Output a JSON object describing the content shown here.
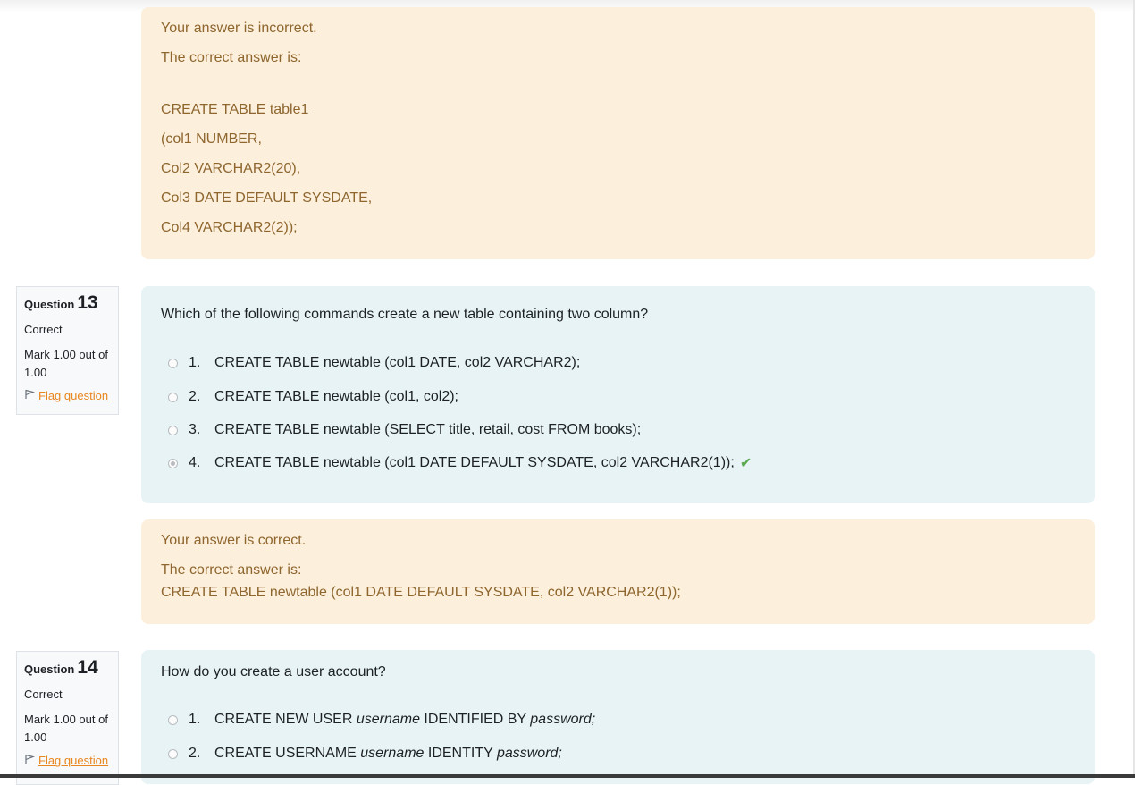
{
  "prev_feedback": {
    "lines": [
      "Your answer is incorrect.",
      "The correct answer is:",
      "CREATE TABLE table1",
      "(col1 NUMBER,",
      "Col2 VARCHAR2(20),",
      "Col3 DATE DEFAULT SYSDATE,",
      "Col4 VARCHAR2(2));"
    ]
  },
  "questions": [
    {
      "label": "Question",
      "number": "13",
      "state": "Correct",
      "grade": "Mark 1.00 out of 1.00",
      "flag": "Flag question",
      "text": "Which of the following commands create a new table containing two column?",
      "options": [
        {
          "num": "1.",
          "text": "CREATE TABLE newtable (col1 DATE, col2 VARCHAR2);"
        },
        {
          "num": "2.",
          "text": "CREATE TABLE newtable (col1, col2);"
        },
        {
          "num": "3.",
          "text": "CREATE TABLE newtable (SELECT title, retail, cost FROM books);"
        },
        {
          "num": "4.",
          "text": "CREATE TABLE newtable (col1 DATE DEFAULT SYSDATE, col2 VARCHAR2(1));"
        }
      ],
      "selected_option": 4,
      "feedback": {
        "result": "Your answer is correct.",
        "correct_label": "The correct answer is:",
        "correct_answer": "CREATE TABLE newtable (col1 DATE DEFAULT SYSDATE, col2 VARCHAR2(1));"
      }
    },
    {
      "label": "Question",
      "number": "14",
      "state": "Correct",
      "grade": "Mark 1.00 out of 1.00",
      "flag": "Flag question",
      "text": "How do you create a user account?",
      "options": [
        {
          "num": "1.",
          "parts": [
            "CREATE NEW USER ",
            "username",
            " IDENTIFIED BY ",
            "password;"
          ]
        },
        {
          "num": "2.",
          "parts": [
            "CREATE USERNAME ",
            "username",
            " IDENTITY ",
            "password;"
          ]
        }
      ]
    }
  ],
  "icons": {
    "flag": "flag-icon",
    "correct": "check-icon",
    "radio": "radio-icon"
  },
  "colors": {
    "feedback_bg": "#fcefdc",
    "feedback_text": "#8e662e",
    "formulation_bg": "#e7f3f5",
    "link": "#e8861f",
    "check": "#5aa950"
  }
}
